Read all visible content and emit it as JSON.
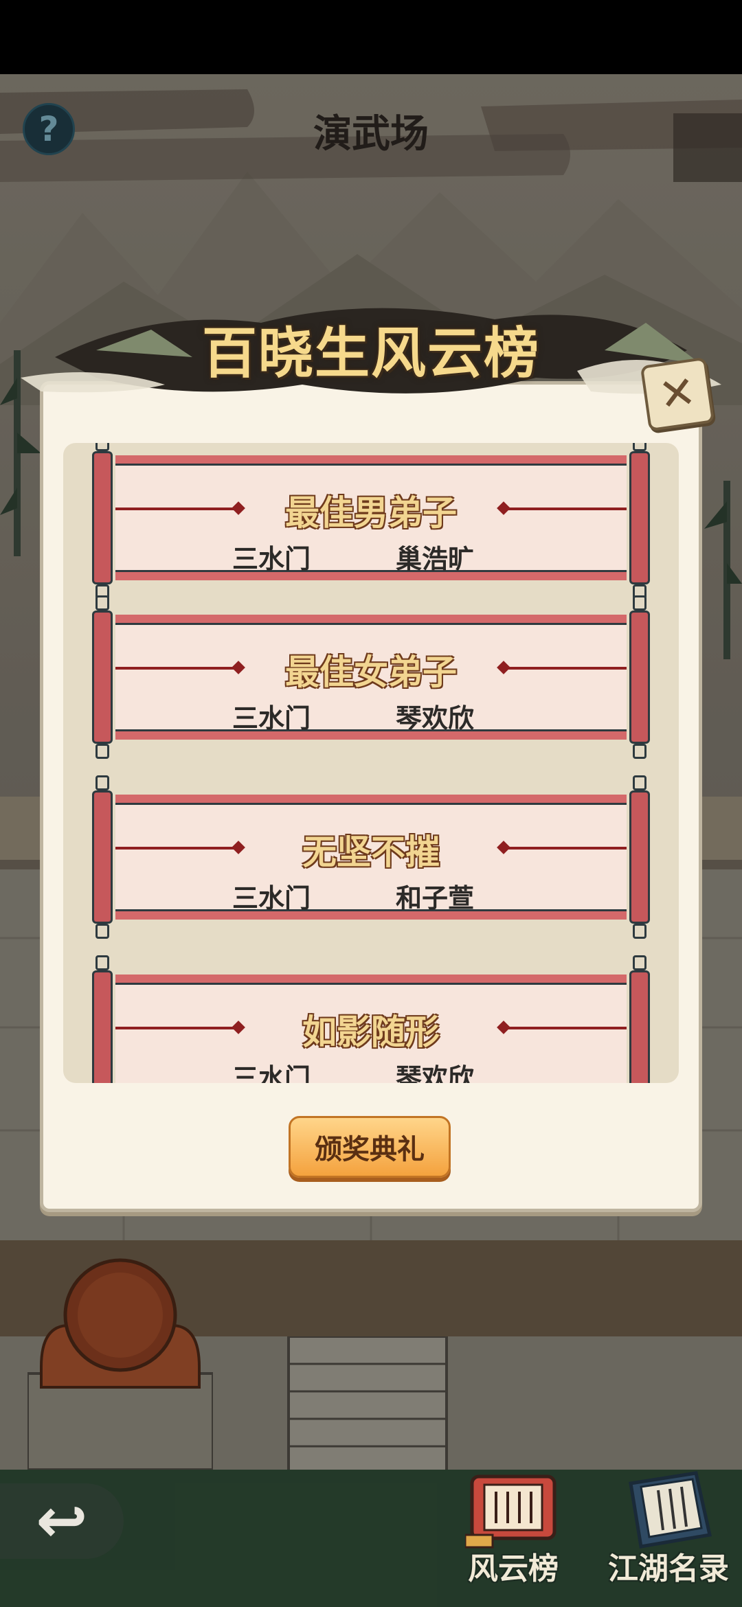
{
  "header": {
    "title": "演武场",
    "help_glyph": "?"
  },
  "modal": {
    "title": "百晓生风云榜",
    "close_glyph": "✕",
    "awards": [
      {
        "title": "最佳男弟子",
        "sect": "三水门",
        "name": "巢浩旷"
      },
      {
        "title": "最佳女弟子",
        "sect": "三水门",
        "name": "琴欢欣"
      },
      {
        "title": "无坚不摧",
        "sect": "三水门",
        "name": "和子萱"
      },
      {
        "title": "如影随形",
        "sect": "三水门",
        "name": "琴欢欣"
      }
    ],
    "ceremony_button": "颁奖典礼"
  },
  "bottom_nav": {
    "back_glyph": "↩",
    "items": [
      {
        "label": "风云榜",
        "icon": "ranking-scroll-icon"
      },
      {
        "label": "江湖名录",
        "icon": "roster-book-icon"
      }
    ]
  },
  "colors": {
    "accent_orange": "#f4a23e",
    "scroll_red": "#d4696a",
    "title_gold": "#f2d591"
  }
}
